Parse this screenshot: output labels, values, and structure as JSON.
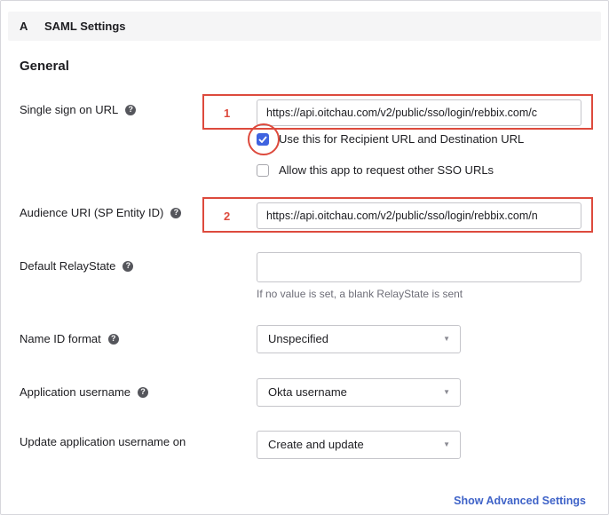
{
  "header": {
    "step_letter": "A",
    "title": "SAML Settings"
  },
  "section": {
    "title": "General"
  },
  "fields": {
    "sso_url": {
      "label": "Single sign on URL",
      "value": "https://api.oitchau.com/v2/public/sso/login/rebbix.com/c",
      "marker": "1"
    },
    "recipient_checkbox": {
      "label": "Use this for Recipient URL and Destination URL",
      "checked": true
    },
    "other_sso_checkbox": {
      "label": "Allow this app to request other SSO URLs",
      "checked": false
    },
    "audience_uri": {
      "label": "Audience URI (SP Entity ID)",
      "value": "https://api.oitchau.com/v2/public/sso/login/rebbix.com/n",
      "marker": "2"
    },
    "relay_state": {
      "label": "Default RelayState",
      "value": "",
      "hint": "If no value is set, a blank RelayState is sent"
    },
    "name_id_format": {
      "label": "Name ID format",
      "selected": "Unspecified"
    },
    "app_username": {
      "label": "Application username",
      "selected": "Okta username"
    },
    "update_username": {
      "label": "Update application username on",
      "selected": "Create and update"
    }
  },
  "links": {
    "show_advanced": "Show Advanced Settings"
  },
  "colors": {
    "highlight": "#dd4a3d",
    "checkbox_checked": "#3f63e0",
    "link": "#3f63c8"
  },
  "icons": {
    "help": "help-circle-icon",
    "check": "checkmark-icon",
    "dropdown": "chevron-down-icon"
  }
}
